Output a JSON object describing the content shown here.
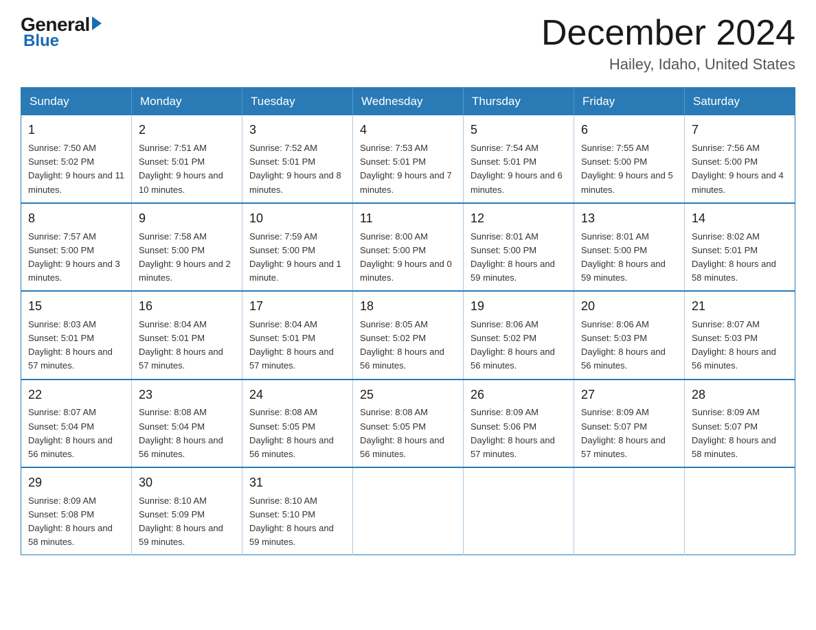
{
  "logo": {
    "general": "General",
    "blue": "Blue"
  },
  "title": "December 2024",
  "location": "Hailey, Idaho, United States",
  "header_color": "#2a7ab5",
  "days_of_week": [
    "Sunday",
    "Monday",
    "Tuesday",
    "Wednesday",
    "Thursday",
    "Friday",
    "Saturday"
  ],
  "weeks": [
    [
      {
        "day": "1",
        "sunrise": "Sunrise: 7:50 AM",
        "sunset": "Sunset: 5:02 PM",
        "daylight": "Daylight: 9 hours and 11 minutes."
      },
      {
        "day": "2",
        "sunrise": "Sunrise: 7:51 AM",
        "sunset": "Sunset: 5:01 PM",
        "daylight": "Daylight: 9 hours and 10 minutes."
      },
      {
        "day": "3",
        "sunrise": "Sunrise: 7:52 AM",
        "sunset": "Sunset: 5:01 PM",
        "daylight": "Daylight: 9 hours and 8 minutes."
      },
      {
        "day": "4",
        "sunrise": "Sunrise: 7:53 AM",
        "sunset": "Sunset: 5:01 PM",
        "daylight": "Daylight: 9 hours and 7 minutes."
      },
      {
        "day": "5",
        "sunrise": "Sunrise: 7:54 AM",
        "sunset": "Sunset: 5:01 PM",
        "daylight": "Daylight: 9 hours and 6 minutes."
      },
      {
        "day": "6",
        "sunrise": "Sunrise: 7:55 AM",
        "sunset": "Sunset: 5:00 PM",
        "daylight": "Daylight: 9 hours and 5 minutes."
      },
      {
        "day": "7",
        "sunrise": "Sunrise: 7:56 AM",
        "sunset": "Sunset: 5:00 PM",
        "daylight": "Daylight: 9 hours and 4 minutes."
      }
    ],
    [
      {
        "day": "8",
        "sunrise": "Sunrise: 7:57 AM",
        "sunset": "Sunset: 5:00 PM",
        "daylight": "Daylight: 9 hours and 3 minutes."
      },
      {
        "day": "9",
        "sunrise": "Sunrise: 7:58 AM",
        "sunset": "Sunset: 5:00 PM",
        "daylight": "Daylight: 9 hours and 2 minutes."
      },
      {
        "day": "10",
        "sunrise": "Sunrise: 7:59 AM",
        "sunset": "Sunset: 5:00 PM",
        "daylight": "Daylight: 9 hours and 1 minute."
      },
      {
        "day": "11",
        "sunrise": "Sunrise: 8:00 AM",
        "sunset": "Sunset: 5:00 PM",
        "daylight": "Daylight: 9 hours and 0 minutes."
      },
      {
        "day": "12",
        "sunrise": "Sunrise: 8:01 AM",
        "sunset": "Sunset: 5:00 PM",
        "daylight": "Daylight: 8 hours and 59 minutes."
      },
      {
        "day": "13",
        "sunrise": "Sunrise: 8:01 AM",
        "sunset": "Sunset: 5:00 PM",
        "daylight": "Daylight: 8 hours and 59 minutes."
      },
      {
        "day": "14",
        "sunrise": "Sunrise: 8:02 AM",
        "sunset": "Sunset: 5:01 PM",
        "daylight": "Daylight: 8 hours and 58 minutes."
      }
    ],
    [
      {
        "day": "15",
        "sunrise": "Sunrise: 8:03 AM",
        "sunset": "Sunset: 5:01 PM",
        "daylight": "Daylight: 8 hours and 57 minutes."
      },
      {
        "day": "16",
        "sunrise": "Sunrise: 8:04 AM",
        "sunset": "Sunset: 5:01 PM",
        "daylight": "Daylight: 8 hours and 57 minutes."
      },
      {
        "day": "17",
        "sunrise": "Sunrise: 8:04 AM",
        "sunset": "Sunset: 5:01 PM",
        "daylight": "Daylight: 8 hours and 57 minutes."
      },
      {
        "day": "18",
        "sunrise": "Sunrise: 8:05 AM",
        "sunset": "Sunset: 5:02 PM",
        "daylight": "Daylight: 8 hours and 56 minutes."
      },
      {
        "day": "19",
        "sunrise": "Sunrise: 8:06 AM",
        "sunset": "Sunset: 5:02 PM",
        "daylight": "Daylight: 8 hours and 56 minutes."
      },
      {
        "day": "20",
        "sunrise": "Sunrise: 8:06 AM",
        "sunset": "Sunset: 5:03 PM",
        "daylight": "Daylight: 8 hours and 56 minutes."
      },
      {
        "day": "21",
        "sunrise": "Sunrise: 8:07 AM",
        "sunset": "Sunset: 5:03 PM",
        "daylight": "Daylight: 8 hours and 56 minutes."
      }
    ],
    [
      {
        "day": "22",
        "sunrise": "Sunrise: 8:07 AM",
        "sunset": "Sunset: 5:04 PM",
        "daylight": "Daylight: 8 hours and 56 minutes."
      },
      {
        "day": "23",
        "sunrise": "Sunrise: 8:08 AM",
        "sunset": "Sunset: 5:04 PM",
        "daylight": "Daylight: 8 hours and 56 minutes."
      },
      {
        "day": "24",
        "sunrise": "Sunrise: 8:08 AM",
        "sunset": "Sunset: 5:05 PM",
        "daylight": "Daylight: 8 hours and 56 minutes."
      },
      {
        "day": "25",
        "sunrise": "Sunrise: 8:08 AM",
        "sunset": "Sunset: 5:05 PM",
        "daylight": "Daylight: 8 hours and 56 minutes."
      },
      {
        "day": "26",
        "sunrise": "Sunrise: 8:09 AM",
        "sunset": "Sunset: 5:06 PM",
        "daylight": "Daylight: 8 hours and 57 minutes."
      },
      {
        "day": "27",
        "sunrise": "Sunrise: 8:09 AM",
        "sunset": "Sunset: 5:07 PM",
        "daylight": "Daylight: 8 hours and 57 minutes."
      },
      {
        "day": "28",
        "sunrise": "Sunrise: 8:09 AM",
        "sunset": "Sunset: 5:07 PM",
        "daylight": "Daylight: 8 hours and 58 minutes."
      }
    ],
    [
      {
        "day": "29",
        "sunrise": "Sunrise: 8:09 AM",
        "sunset": "Sunset: 5:08 PM",
        "daylight": "Daylight: 8 hours and 58 minutes."
      },
      {
        "day": "30",
        "sunrise": "Sunrise: 8:10 AM",
        "sunset": "Sunset: 5:09 PM",
        "daylight": "Daylight: 8 hours and 59 minutes."
      },
      {
        "day": "31",
        "sunrise": "Sunrise: 8:10 AM",
        "sunset": "Sunset: 5:10 PM",
        "daylight": "Daylight: 8 hours and 59 minutes."
      },
      null,
      null,
      null,
      null
    ]
  ]
}
